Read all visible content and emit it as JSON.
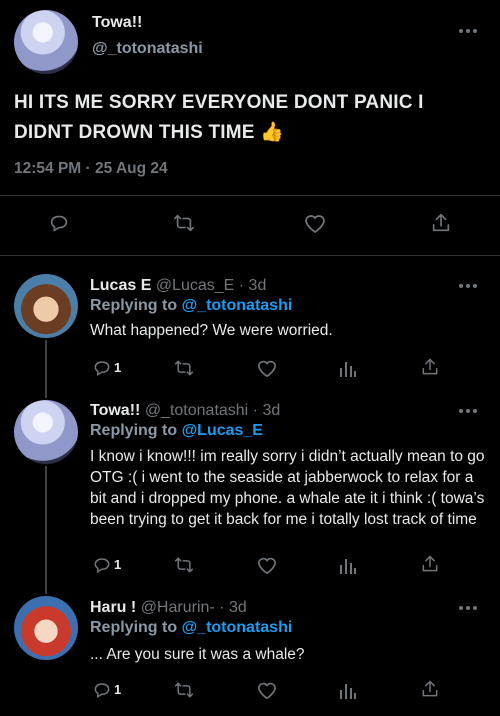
{
  "main_tweet": {
    "display_name": "Towa!!",
    "handle": "@_totonatashi",
    "text": "HI ITS ME SORRY EVERYONE DONT PANIC I DIDNT DROWN THIS TIME",
    "emoji": "👍",
    "timestamp": "12:54 PM · 25 Aug 24"
  },
  "replies": [
    {
      "display_name": "Lucas E",
      "handle_time": "@Lucas_E · 3d",
      "replying_prefix": "Replying to ",
      "replying_to": "@_totonatashi",
      "text": "What happened? We were worried.",
      "reply_count": "1"
    },
    {
      "display_name": "Towa!!",
      "handle_time": "@_totonatashi · 3d",
      "replying_prefix": "Replying to ",
      "replying_to": "@Lucas_E",
      "text": "I know i know!!! im really sorry i didn’t actually mean to go OTG :( i went to the seaside at jabberwock to relax for a bit and i dropped my phone. a whale ate it i think :( towa’s been trying to get it back for me i totally lost track of time",
      "reply_count": "1"
    },
    {
      "display_name": "Haru !",
      "handle_time": "@Harurin- · 3d",
      "replying_prefix": "Replying to ",
      "replying_to": "@_totonatashi",
      "text": "... Are you sure it was a whale?",
      "reply_count": "1"
    }
  ],
  "icons": {
    "reply": "reply-icon",
    "retweet": "retweet-icon",
    "like": "heart-icon",
    "views": "analytics-icon",
    "share": "share-icon",
    "more": "more-dots-icon"
  },
  "colors": {
    "background": "#000000",
    "text": "#e7e9ea",
    "muted": "#71767b",
    "accent": "#1d9bf0",
    "divider": "#2f3336"
  }
}
